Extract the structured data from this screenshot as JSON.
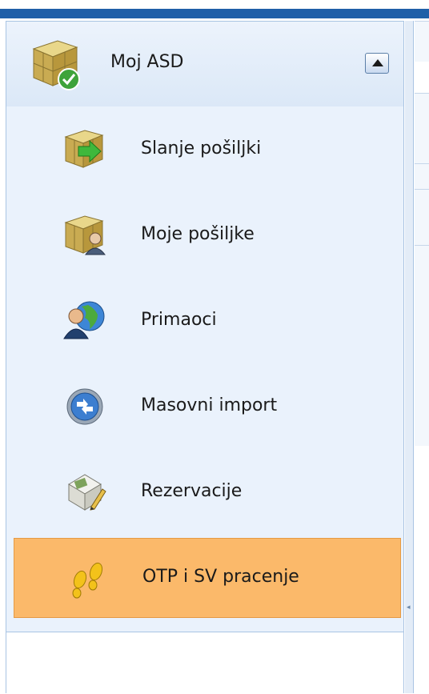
{
  "header": {
    "title": "Moj ASD",
    "icon": "boxes-check-icon",
    "collapse_icon": "chevron-up-icon"
  },
  "menu": {
    "items": [
      {
        "label": "Slanje pošiljki",
        "icon": "boxes-send-icon"
      },
      {
        "label": "Moje pošiljke",
        "icon": "boxes-user-icon"
      },
      {
        "label": "Primaoci",
        "icon": "user-globe-icon"
      },
      {
        "label": "Masovni import",
        "icon": "import-circle-icon"
      },
      {
        "label": "Rezervacije",
        "icon": "reservation-edit-icon"
      },
      {
        "label": "OTP i SV pracenje",
        "icon": "footprints-icon",
        "selected": true
      }
    ]
  },
  "colors": {
    "topbar": "#1f5fa8",
    "selected_bg": "#fbb96a",
    "list_bg": "#eaf2fc"
  }
}
